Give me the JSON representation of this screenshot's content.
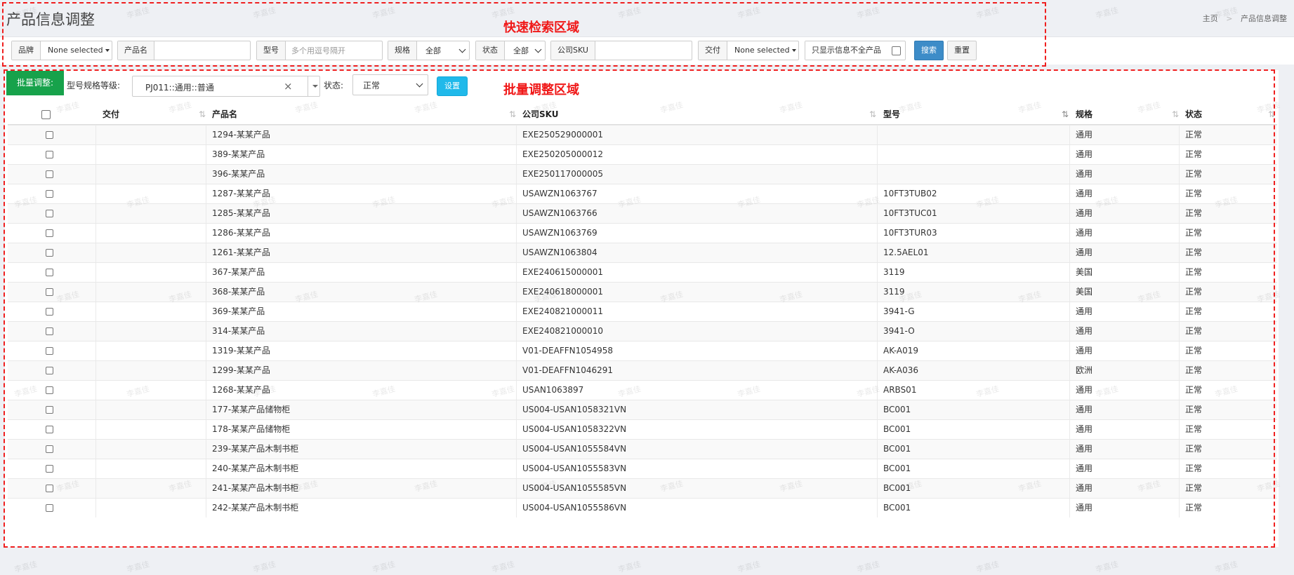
{
  "page": {
    "title": "产品信息调整"
  },
  "breadcrumb": {
    "home": "主页",
    "separator": ">",
    "current": "产品信息调整"
  },
  "annotations": {
    "search_area": "快速检索区域",
    "batch_area": "批量调整区域"
  },
  "filters": {
    "brand": {
      "label": "品牌",
      "value": "None selected"
    },
    "product_name": {
      "label": "产品名",
      "value": ""
    },
    "model": {
      "label": "型号",
      "placeholder": "多个用逗号隔开"
    },
    "spec": {
      "label": "规格",
      "value": "全部"
    },
    "status": {
      "label": "状态",
      "value": "全部"
    },
    "company_sku": {
      "label": "公司SKU",
      "value": ""
    },
    "delivery": {
      "label": "交付",
      "value": "None selected"
    },
    "only_incomplete": {
      "label": "只显示信息不全产品",
      "checked": false
    },
    "search_label": "搜索",
    "reset_label": "重置"
  },
  "batch": {
    "label": "批量调整:",
    "model_grade_label": "型号规格等级:",
    "model_grade_value": "PJ011::通用::普通",
    "status_label": "状态:",
    "status_value": "正常",
    "set_label": "设置"
  },
  "table": {
    "columns": [
      "交付",
      "产品名",
      "公司SKU",
      "型号",
      "规格",
      "状态"
    ],
    "rows": [
      {
        "delivery": "",
        "name": "1294-某某产品",
        "sku": "EXE250529000001",
        "model": "",
        "spec": "通用",
        "status": "正常"
      },
      {
        "delivery": "",
        "name": "389-某某产品",
        "sku": "EXE250205000012",
        "model": "",
        "spec": "通用",
        "status": "正常"
      },
      {
        "delivery": "",
        "name": "396-某某产品",
        "sku": "EXE250117000005",
        "model": "",
        "spec": "通用",
        "status": "正常"
      },
      {
        "delivery": "",
        "name": "1287-某某产品",
        "sku": "USAWZN1063767",
        "model": "10FT3TUB02",
        "spec": "通用",
        "status": "正常"
      },
      {
        "delivery": "",
        "name": "1285-某某产品",
        "sku": "USAWZN1063766",
        "model": "10FT3TUC01",
        "spec": "通用",
        "status": "正常"
      },
      {
        "delivery": "",
        "name": "1286-某某产品",
        "sku": "USAWZN1063769",
        "model": "10FT3TUR03",
        "spec": "通用",
        "status": "正常"
      },
      {
        "delivery": "",
        "name": "1261-某某产品",
        "sku": "USAWZN1063804",
        "model": "12.5AEL01",
        "spec": "通用",
        "status": "正常"
      },
      {
        "delivery": "",
        "name": "367-某某产品",
        "sku": "EXE240615000001",
        "model": "3119",
        "spec": "美国",
        "status": "正常"
      },
      {
        "delivery": "",
        "name": "368-某某产品",
        "sku": "EXE240618000001",
        "model": "3119",
        "spec": "美国",
        "status": "正常"
      },
      {
        "delivery": "",
        "name": "369-某某产品",
        "sku": "EXE240821000011",
        "model": "3941-G",
        "spec": "通用",
        "status": "正常"
      },
      {
        "delivery": "",
        "name": "314-某某产品",
        "sku": "EXE240821000010",
        "model": "3941-O",
        "spec": "通用",
        "status": "正常"
      },
      {
        "delivery": "",
        "name": "1319-某某产品",
        "sku": "V01-DEAFFN1054958",
        "model": "AK-A019",
        "spec": "通用",
        "status": "正常"
      },
      {
        "delivery": "",
        "name": "1299-某某产品",
        "sku": "V01-DEAFFN1046291",
        "model": "AK-A036",
        "spec": "欧洲",
        "status": "正常"
      },
      {
        "delivery": "",
        "name": "1268-某某产品",
        "sku": "USAN1063897",
        "model": "ARBS01",
        "spec": "通用",
        "status": "正常"
      },
      {
        "delivery": "",
        "name": "177-某某产品储物柜",
        "sku": "US004-USAN1058321VN",
        "model": "BC001",
        "spec": "通用",
        "status": "正常"
      },
      {
        "delivery": "",
        "name": "178-某某产品储物柜",
        "sku": "US004-USAN1058322VN",
        "model": "BC001",
        "spec": "通用",
        "status": "正常"
      },
      {
        "delivery": "",
        "name": "239-某某产品木制书柜",
        "sku": "US004-USAN1055584VN",
        "model": "BC001",
        "spec": "通用",
        "status": "正常"
      },
      {
        "delivery": "",
        "name": "240-某某产品木制书柜",
        "sku": "US004-USAN1055583VN",
        "model": "BC001",
        "spec": "通用",
        "status": "正常"
      },
      {
        "delivery": "",
        "name": "241-某某产品木制书柜",
        "sku": "US004-USAN1055585VN",
        "model": "BC001",
        "spec": "通用",
        "status": "正常"
      },
      {
        "delivery": "",
        "name": "242-某某产品木制书柜",
        "sku": "US004-USAN1055586VN",
        "model": "BC001",
        "spec": "通用",
        "status": "正常"
      }
    ]
  },
  "watermark": "李嘉佳",
  "colors": {
    "batch_green": "#17a24b",
    "search_blue": "#3d8cc8",
    "set_cyan": "#20b9ea",
    "annotation_red": "#ef1f1f"
  },
  "icons": {
    "sort": "sort-arrows-icon",
    "clear": "clear-x-icon",
    "caret": "caret-down-icon"
  }
}
